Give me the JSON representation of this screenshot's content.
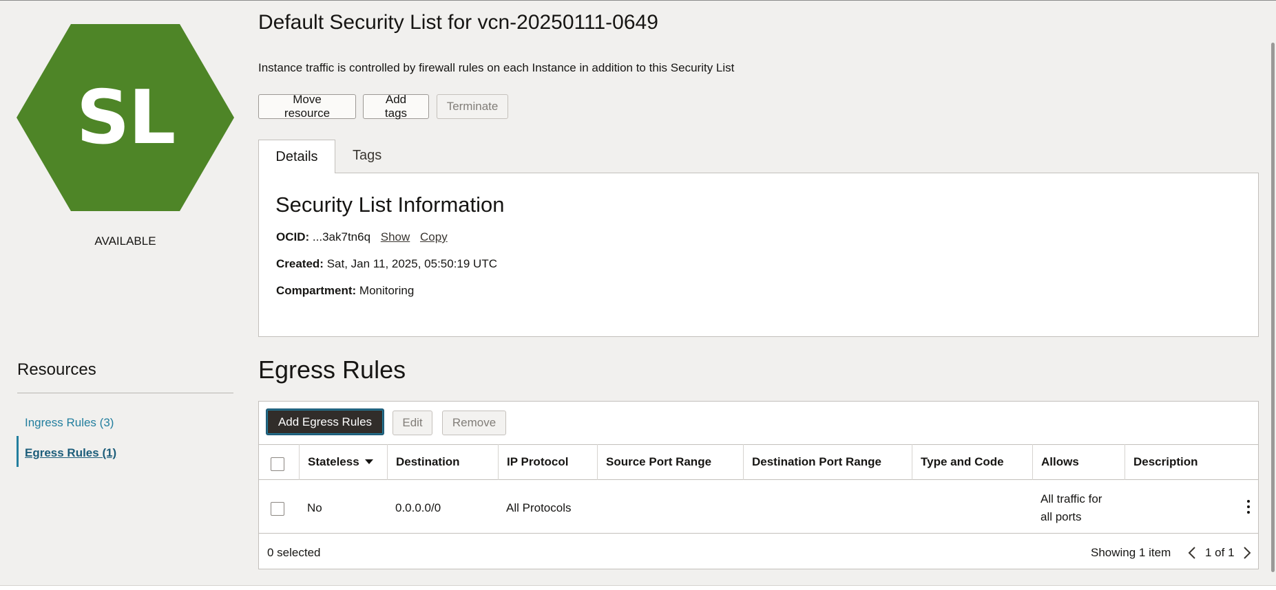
{
  "header": {
    "title": "Default Security List for vcn-20250111-0649",
    "subtitle": "Instance traffic is controlled by firewall rules on each Instance in addition to this Security List"
  },
  "badge": {
    "letters": "SL",
    "status": "AVAILABLE",
    "color": "#4e8527"
  },
  "actions": {
    "move": "Move resource",
    "add_tags": "Add tags",
    "terminate": "Terminate"
  },
  "tabs": [
    "Details",
    "Tags"
  ],
  "details": {
    "title": "Security List Information",
    "ocid_label": "OCID:",
    "ocid_value": "...3ak7tn6q",
    "show_link": "Show",
    "copy_link": "Copy",
    "created_label": "Created:",
    "created_value": "Sat, Jan 11, 2025, 05:50:19 UTC",
    "compartment_label": "Compartment:",
    "compartment_value": "Monitoring"
  },
  "resources": {
    "title": "Resources",
    "items": [
      "Ingress Rules (3)",
      "Egress Rules (1)"
    ]
  },
  "egress": {
    "title": "Egress Rules",
    "add_button": "Add Egress Rules",
    "edit_button": "Edit",
    "remove_button": "Remove",
    "columns": [
      "Stateless",
      "Destination",
      "IP Protocol",
      "Source Port Range",
      "Destination Port Range",
      "Type and Code",
      "Allows",
      "Description"
    ],
    "rows": [
      {
        "stateless": "No",
        "destination": "0.0.0.0/0",
        "protocol": "All Protocols",
        "source_port": "",
        "dest_port": "",
        "type_code": "",
        "allows_line1": "All traffic for",
        "allows_line2": "all ports",
        "description": ""
      }
    ],
    "selected_count": "0 selected",
    "showing": "Showing 1 item",
    "page": "1 of 1"
  }
}
